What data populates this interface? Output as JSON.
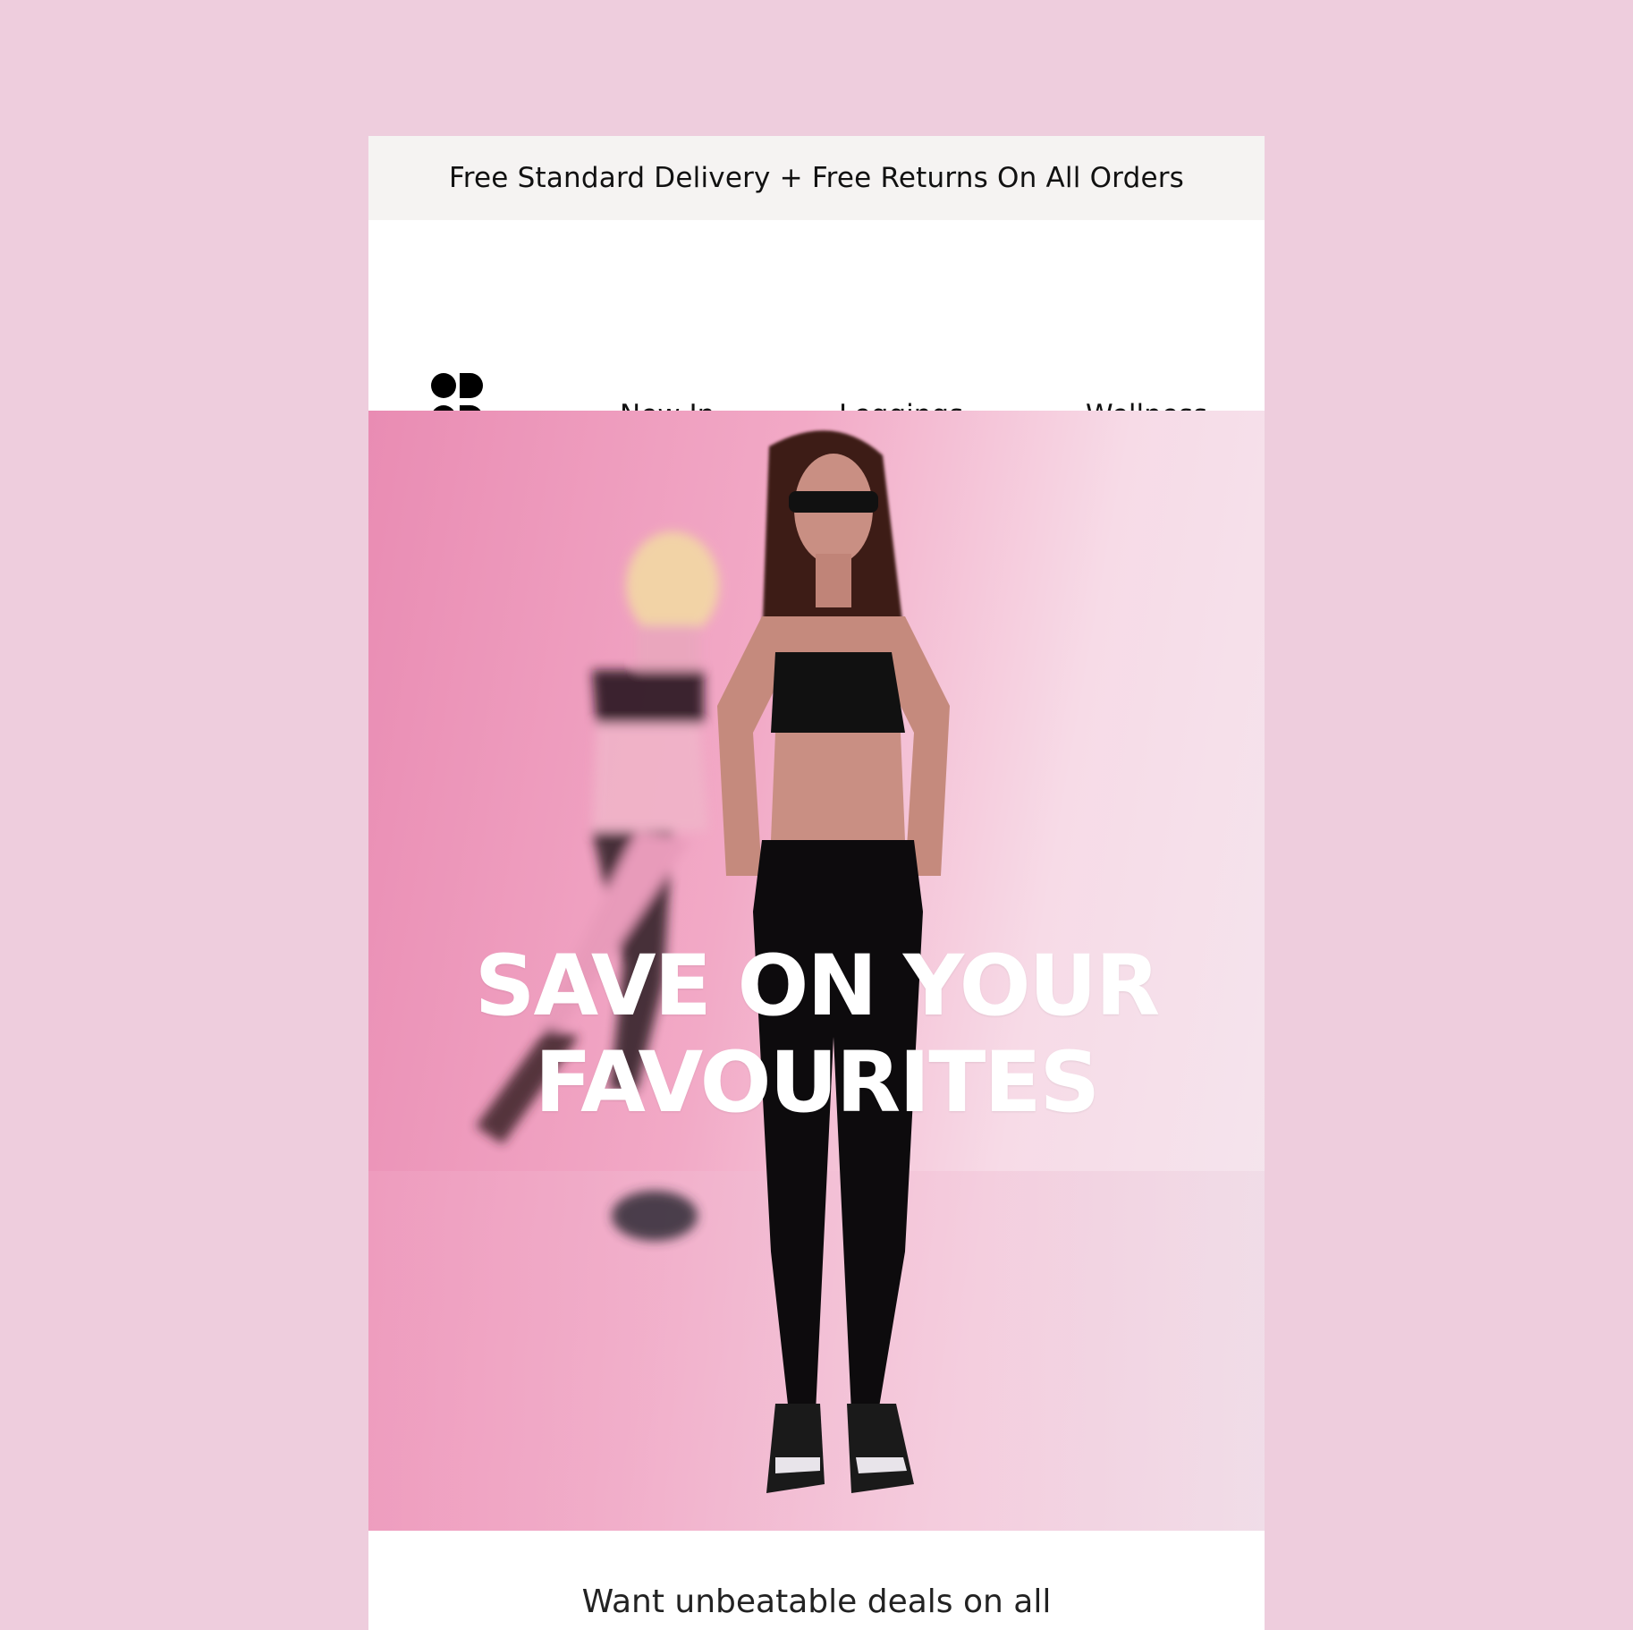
{
  "banner": {
    "text": "Free Standard Delivery + Free Returns On All Orders"
  },
  "header": {
    "logo_icon": "four-circles-logo-icon",
    "nav": [
      {
        "label": "New In"
      },
      {
        "label": "Leggings"
      },
      {
        "label": "Wellness"
      }
    ]
  },
  "hero": {
    "headline_line1": "SAVE ON YOUR",
    "headline_line2": "FAVOURITES",
    "image_icon": "hero-photo"
  },
  "content": {
    "intro_text": "Want unbeatable deals on all"
  },
  "colors": {
    "page_background": "#eecddd",
    "banner_background": "#f5f3f2",
    "hero_pink": "#e98cb3",
    "text": "#111111"
  }
}
